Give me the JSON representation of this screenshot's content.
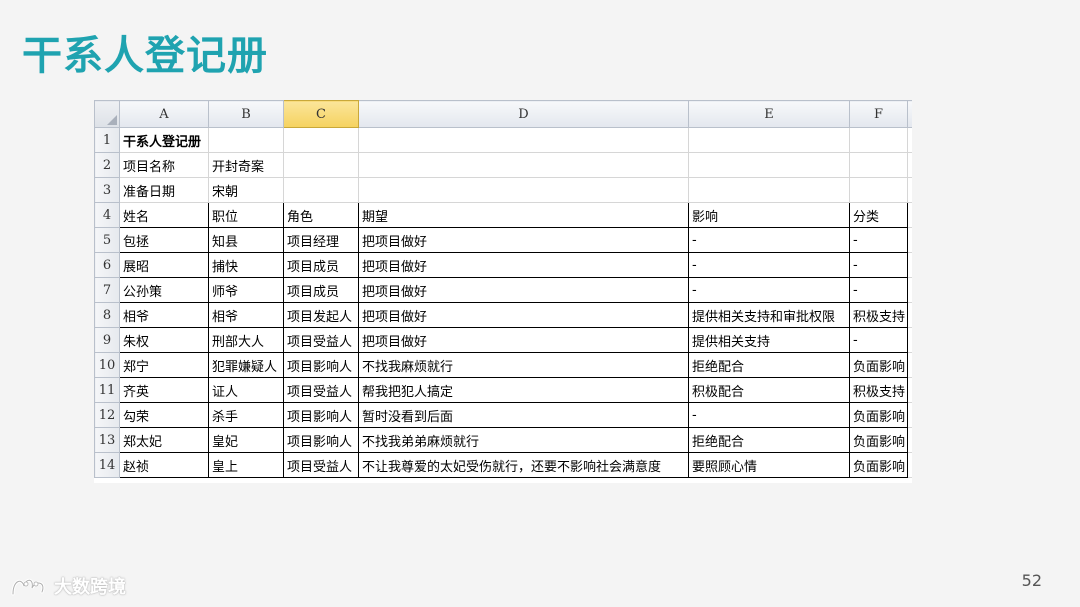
{
  "slide": {
    "title": "干系人登记册",
    "page_number": "52",
    "logo_text": "大数跨境"
  },
  "sheet": {
    "columns": [
      "A",
      "B",
      "C",
      "D",
      "E",
      "F"
    ],
    "active_column": "C",
    "rows": [
      {
        "n": "1",
        "cells": [
          "干系人登记册",
          "",
          "",
          "",
          "",
          ""
        ]
      },
      {
        "n": "2",
        "cells": [
          "项目名称",
          "开封奇案",
          "",
          "",
          "",
          ""
        ]
      },
      {
        "n": "3",
        "cells": [
          "准备日期",
          "宋朝",
          "",
          "",
          "",
          ""
        ]
      },
      {
        "n": "4",
        "cells": [
          "姓名",
          "职位",
          "角色",
          "期望",
          "影响",
          "分类"
        ]
      },
      {
        "n": "5",
        "cells": [
          "包拯",
          "知县",
          "项目经理",
          "把项目做好",
          "-",
          "-"
        ]
      },
      {
        "n": "6",
        "cells": [
          "展昭",
          "捕快",
          "项目成员",
          "把项目做好",
          "-",
          "-"
        ]
      },
      {
        "n": "7",
        "cells": [
          "公孙策",
          "师爷",
          "项目成员",
          "把项目做好",
          "-",
          "-"
        ]
      },
      {
        "n": "8",
        "cells": [
          "相爷",
          "相爷",
          "项目发起人",
          "把项目做好",
          "提供相关支持和审批权限",
          "积极支持"
        ]
      },
      {
        "n": "9",
        "cells": [
          "朱权",
          "刑部大人",
          "项目受益人",
          "把项目做好",
          "提供相关支持",
          "-"
        ]
      },
      {
        "n": "10",
        "cells": [
          "郑宁",
          "犯罪嫌疑人",
          "项目影响人",
          "不找我麻烦就行",
          "拒绝配合",
          "负面影响"
        ]
      },
      {
        "n": "11",
        "cells": [
          "齐英",
          "证人",
          "项目受益人",
          "帮我把犯人搞定",
          "积极配合",
          "积极支持"
        ]
      },
      {
        "n": "12",
        "cells": [
          "勾荣",
          "杀手",
          "项目影响人",
          "暂时没看到后面",
          "-",
          "负面影响"
        ]
      },
      {
        "n": "13",
        "cells": [
          "郑太妃",
          "皇妃",
          "项目影响人",
          "不找我弟弟麻烦就行",
          "拒绝配合",
          "负面影响"
        ]
      },
      {
        "n": "14",
        "cells": [
          "赵祯",
          "皇上",
          "项目受益人",
          "不让我尊爱的太妃受伤就行，还要不影响社会满意度",
          "要照顾心情",
          "负面影响"
        ]
      }
    ]
  },
  "colors": {
    "title": "#1fa3b0",
    "active_header": "#f5d260",
    "background": "#f4f4f4"
  }
}
